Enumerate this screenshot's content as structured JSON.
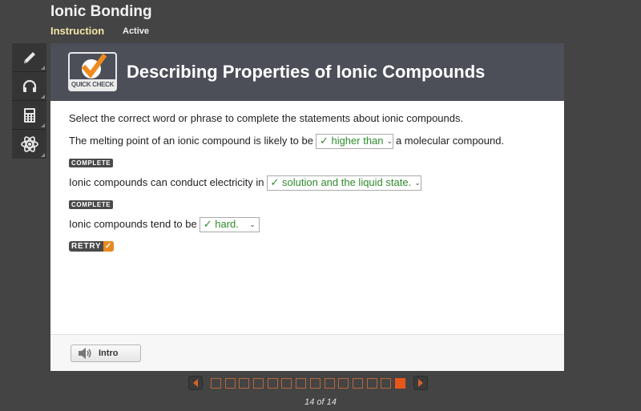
{
  "app": {
    "title": "Ionic Bonding",
    "tabs": [
      {
        "label": "Instruction",
        "selected": true
      },
      {
        "label": "Active",
        "selected": false
      }
    ]
  },
  "toolbar": {
    "items": [
      {
        "name": "pencil-icon",
        "tooltip": ""
      },
      {
        "name": "headphones-icon",
        "tooltip": ""
      },
      {
        "name": "calculator-icon",
        "tooltip": ""
      },
      {
        "name": "atom-icon",
        "tooltip": ""
      }
    ]
  },
  "header": {
    "logo_label": "QUICK CHECK",
    "title": "Describing Properties of Ionic Compounds"
  },
  "content": {
    "instructions": "Select the correct word or phrase to complete the statements about ionic compounds.",
    "questions": [
      {
        "before": "The melting point of an ionic compound is likely to be",
        "selected": "✓ higher than",
        "after": "a molecular compound.",
        "status": "COMPLETE"
      },
      {
        "before": "Ionic compounds can conduct electricity in",
        "selected": "✓ solution and the liquid state.",
        "after": "",
        "status": "COMPLETE"
      },
      {
        "before": "Ionic compounds tend to be",
        "selected": "✓ hard.",
        "after": "",
        "status": "RETRY"
      }
    ],
    "retry_check": "✓"
  },
  "footer": {
    "intro_button": "Intro"
  },
  "pager": {
    "current": 14,
    "total": 14,
    "label": "14 of 14"
  },
  "colors": {
    "accent_orange": "#e8571a",
    "correct_green": "#2e8b2e",
    "header_bg": "#4c4f58"
  }
}
